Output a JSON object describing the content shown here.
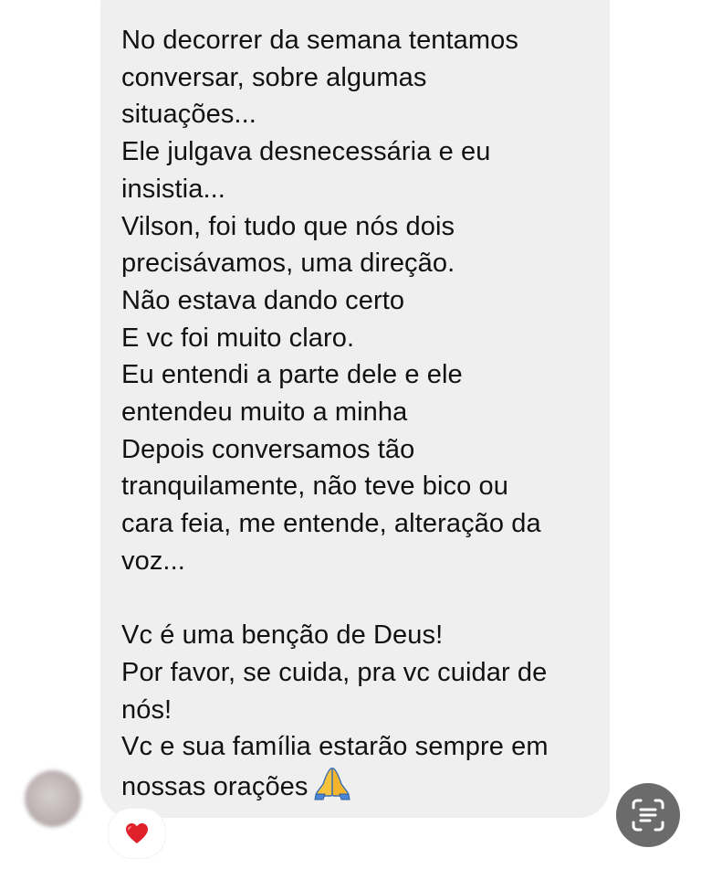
{
  "message": {
    "lines": [
      "No decorrer da semana tentamos",
      "conversar, sobre algumas",
      "situações...",
      "Ele julgava desnecessária e eu",
      "insistia...",
      "Vilson, foi tudo que nós dois",
      "precisávamos, uma direção.",
      "Não estava dando certo",
      "E vc foi muito claro.",
      "Eu entendi a parte dele e ele",
      "entendeu muito a minha",
      "Depois conversamos tão",
      "tranquilamente, não teve bico ou",
      "cara feia, me entende, alteração da",
      "voz...",
      "",
      "Vc é uma benção de Deus!",
      "Por favor, se cuida, pra vc cuidar de",
      "nós!",
      "Vc e sua família estarão sempre em",
      "nossas orações"
    ],
    "trailing_emoji": "praying-hands"
  },
  "reaction": {
    "icon": "heart-icon",
    "color": "#e0202a"
  },
  "colors": {
    "bubble": "#efefef",
    "text": "#111111",
    "scan_button": "#6b6b6b"
  },
  "icons": {
    "avatar": "blurred-avatar",
    "live_text": "text-scan-icon"
  }
}
